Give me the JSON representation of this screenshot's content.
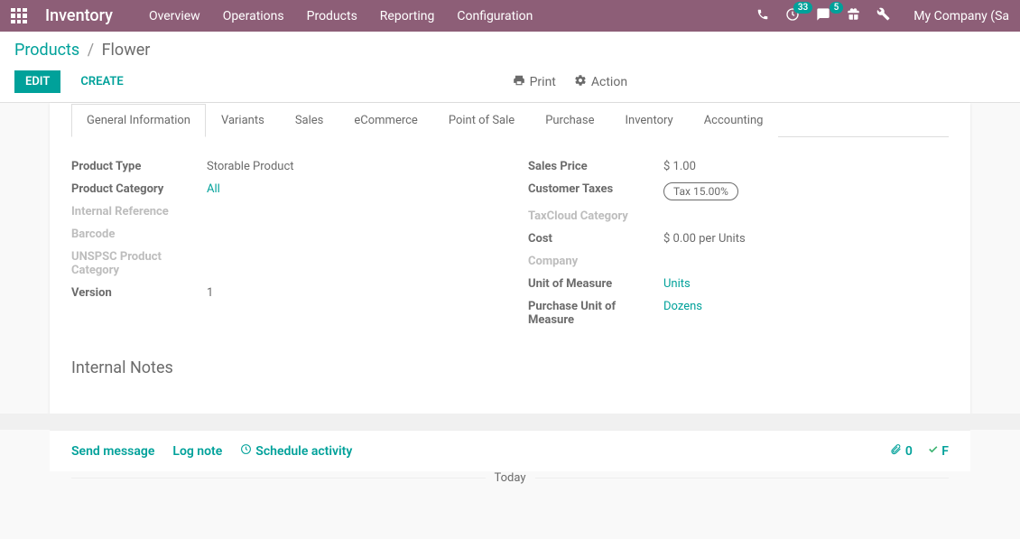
{
  "nav": {
    "brand": "Inventory",
    "items": [
      "Overview",
      "Operations",
      "Products",
      "Reporting",
      "Configuration"
    ],
    "badge_activities": "33",
    "badge_discuss": "5",
    "company": "My Company (Sa"
  },
  "breadcrumb": {
    "parent": "Products",
    "current": "Flower"
  },
  "buttons": {
    "edit": "EDIT",
    "create": "CREATE",
    "print": "Print",
    "action": "Action"
  },
  "tabs": [
    "General Information",
    "Variants",
    "Sales",
    "eCommerce",
    "Point of Sale",
    "Purchase",
    "Inventory",
    "Accounting"
  ],
  "left": {
    "product_type_label": "Product Type",
    "product_type": "Storable Product",
    "product_category_label": "Product Category",
    "product_category": "All",
    "internal_ref_label": "Internal Reference",
    "barcode_label": "Barcode",
    "unspsc_label": "UNSPSC Product Category",
    "version_label": "Version",
    "version": "1"
  },
  "right": {
    "sales_price_label": "Sales Price",
    "sales_price": "$ 1.00",
    "customer_taxes_label": "Customer Taxes",
    "customer_taxes": "Tax 15.00%",
    "taxcloud_label": "TaxCloud Category",
    "cost_label": "Cost",
    "cost": "$ 0.00",
    "cost_per": "per Units",
    "company_label": "Company",
    "uom_label": "Unit of Measure",
    "uom": "Units",
    "puom_label": "Purchase Unit of Measure",
    "puom": "Dozens"
  },
  "section_internal_notes": "Internal Notes",
  "chatter": {
    "send": "Send message",
    "log": "Log note",
    "schedule": "Schedule activity",
    "attach_count": "0",
    "follow": "F"
  },
  "today_label": "Today"
}
